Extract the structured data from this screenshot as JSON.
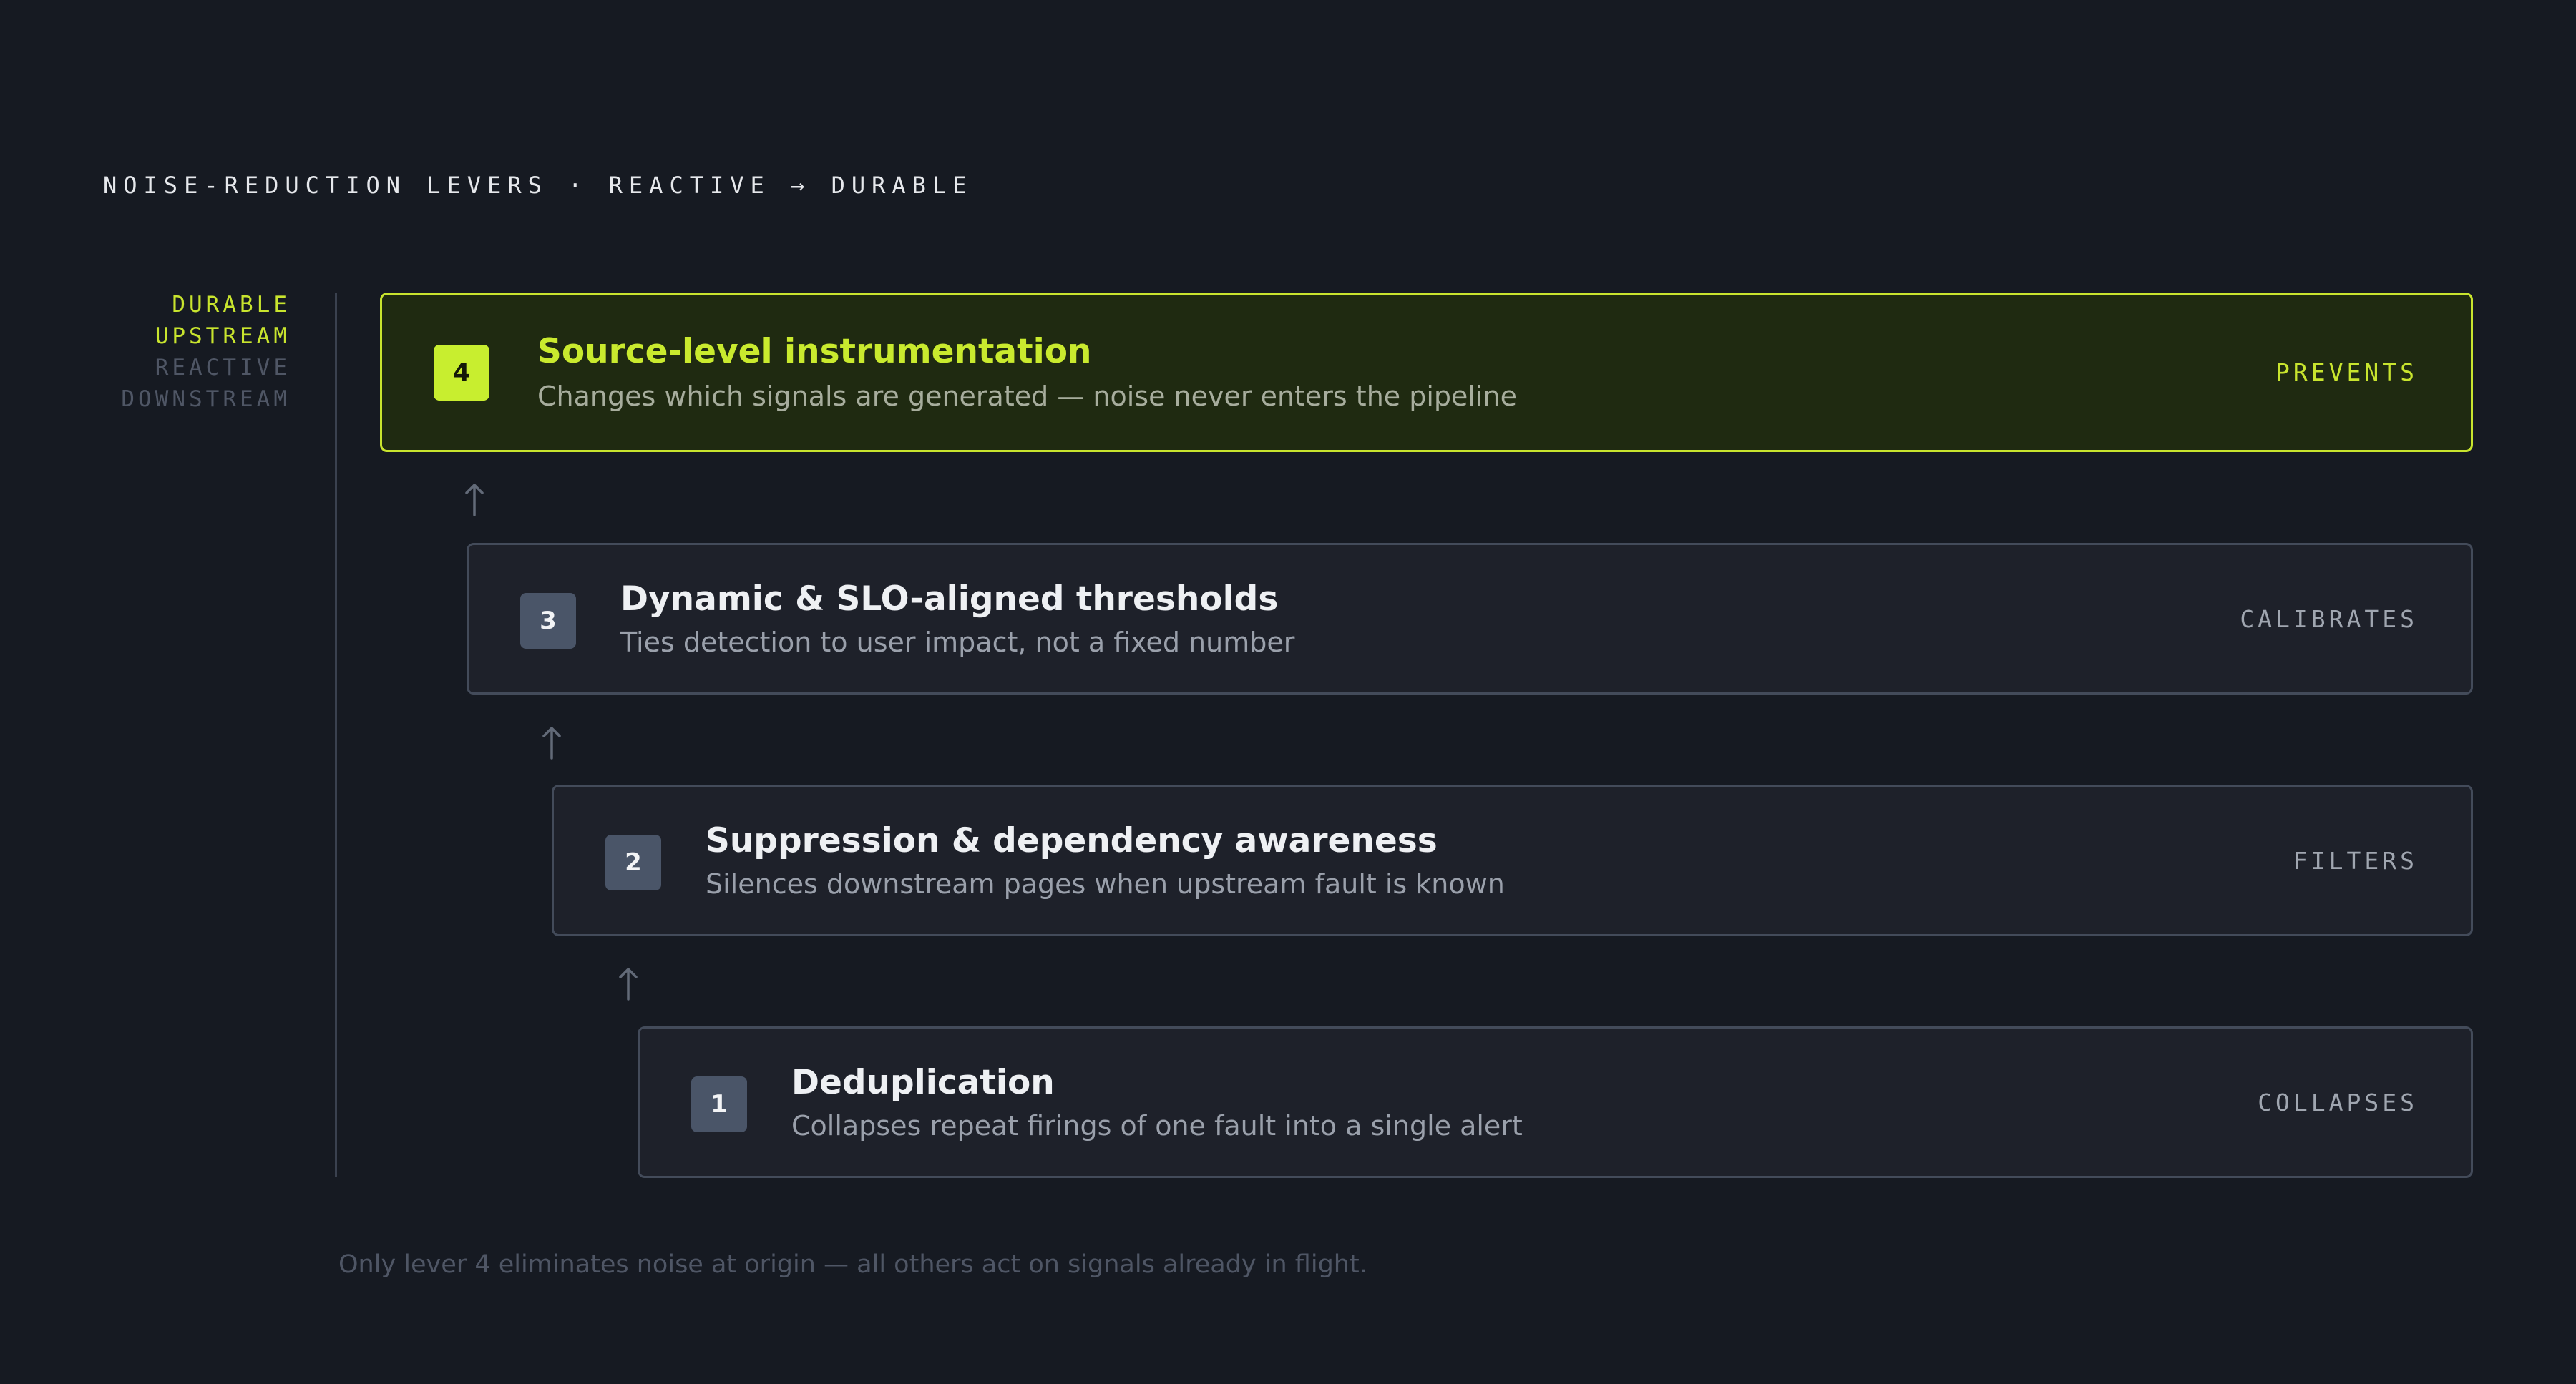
{
  "header": {
    "title": "NOISE-REDUCTION LEVERS · REACTIVE → DURABLE"
  },
  "legend": {
    "items": [
      "DURABLE",
      "UPSTREAM",
      "REACTIVE",
      "DOWNSTREAM"
    ]
  },
  "levers": [
    {
      "number": "4",
      "title": "Source-level instrumentation",
      "description": "Changes which signals are generated — noise never enters the pipeline",
      "tag": "PREVENTS",
      "highlighted": true
    },
    {
      "number": "3",
      "title": "Dynamic & SLO-aligned thresholds",
      "description": "Ties detection to user impact, not a fixed number",
      "tag": "CALIBRATES",
      "highlighted": false
    },
    {
      "number": "2",
      "title": "Suppression & dependency awareness",
      "description": "Silences downstream pages when upstream fault is known",
      "tag": "FILTERS",
      "highlighted": false
    },
    {
      "number": "1",
      "title": "Deduplication",
      "description": "Collapses repeat firings of one fault into a single alert",
      "tag": "COLLAPSES",
      "highlighted": false
    }
  ],
  "footnote": "Only lever 4 eliminates noise at origin — all others act on signals already in flight.",
  "colors": {
    "background": "#161a22",
    "accent": "#c8e42e",
    "card": "#1e212a",
    "card_border": "#434b5a",
    "muted": "#4f5665"
  }
}
